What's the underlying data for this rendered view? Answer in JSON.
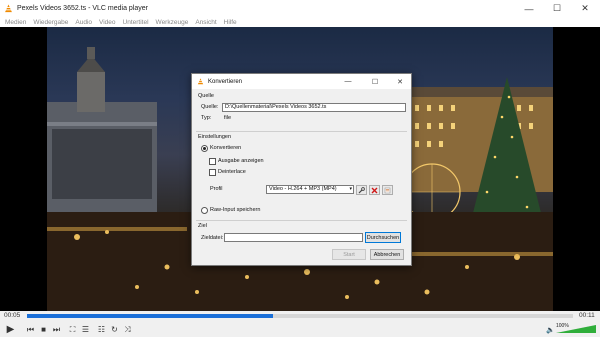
{
  "window": {
    "title": "Pexels Videos 3652.ts - VLC media player",
    "minimize_glyph": "—",
    "maximize_glyph": "☐",
    "close_glyph": "✕"
  },
  "menu": [
    "Medien",
    "Wiedergabe",
    "Audio",
    "Video",
    "Untertitel",
    "Werkzeuge",
    "Ansicht",
    "Hilfe"
  ],
  "playback": {
    "elapsed": "00:05",
    "total": "00:11",
    "progress": 0.45,
    "volume_label": "100%",
    "volume": 1.0
  },
  "controls": {
    "play_glyph": "▶",
    "prev_glyph": "⏮",
    "stop_glyph": "■",
    "next_glyph": "⏭",
    "fullscreen_glyph": "⛶",
    "ext_glyph": "☰",
    "playlist_glyph": "☷",
    "loop_glyph": "↻",
    "shuffle_glyph": "⤨",
    "speaker_glyph": "🔈"
  },
  "dialog": {
    "title": "Konvertieren",
    "minimize_glyph": "—",
    "maximize_glyph": "☐",
    "close_glyph": "✕",
    "source": {
      "header": "Quelle",
      "source_label": "Quelle:",
      "source_value": "D:\\Quellenmaterial\\Pexels Videos 3652.ts",
      "type_label": "Typ:",
      "type_value": "file"
    },
    "settings": {
      "header": "Einstellungen",
      "convert_label": "Konvertieren",
      "show_output_label": "Ausgabe anzeigen",
      "deinterlace_label": "Deinterlace",
      "profile_label": "Profil",
      "profile_value": "Video - H.264 + MP3 (MP4)",
      "raw_input_label": "Raw-Input speichern"
    },
    "destination": {
      "header": "Ziel",
      "file_label": "Zieldatei:",
      "file_value": "",
      "browse_label": "Durchsuchen"
    },
    "start_label": "Start",
    "cancel_label": "Abbrechen"
  }
}
